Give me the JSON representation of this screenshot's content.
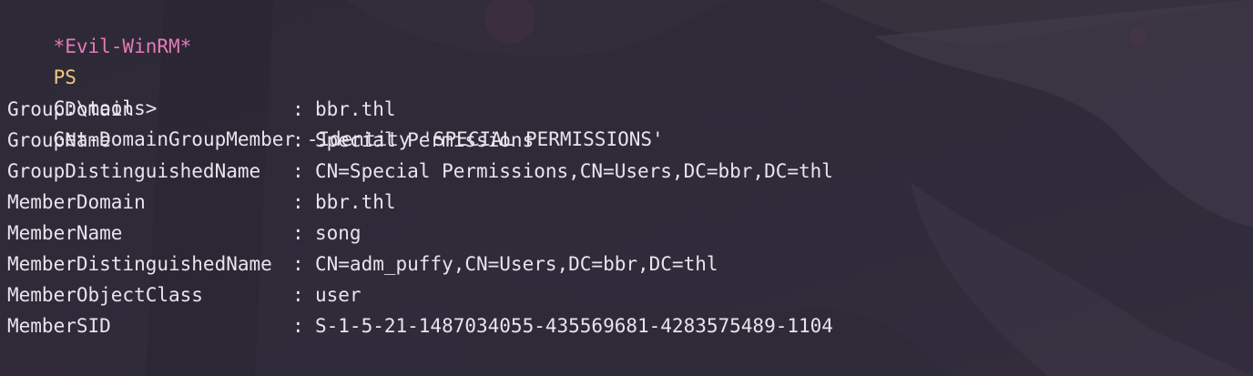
{
  "terminal": {
    "prompt_shell": "*Evil-WinRM*",
    "prompt_ps": "PS",
    "prompt_cwd": "C:\\tools>",
    "command": "Get-DomainGroupMember -Identity 'SPECIAL PERMISSIONS'",
    "separator": ":",
    "output": [
      {
        "key": "GroupDomain",
        "value": "bbr.thl"
      },
      {
        "key": "GroupName",
        "value": "Special Permissions"
      },
      {
        "key": "GroupDistinguishedName",
        "value": "CN=Special Permissions,CN=Users,DC=bbr,DC=thl"
      },
      {
        "key": "MemberDomain",
        "value": "bbr.thl"
      },
      {
        "key": "MemberName",
        "value": "song"
      },
      {
        "key": "MemberDistinguishedName",
        "value": "CN=adm_puffy,CN=Users,DC=bbr,DC=thl"
      },
      {
        "key": "MemberObjectClass",
        "value": "user"
      },
      {
        "key": "MemberSID",
        "value": "S-1-5-21-1487034055-435569681-4283575489-1104"
      }
    ]
  },
  "colors": {
    "background": "#2a2633",
    "prompt_shell": "#e77ab8",
    "prompt_ps": "#f2c97d",
    "text": "#e8e4ec"
  }
}
